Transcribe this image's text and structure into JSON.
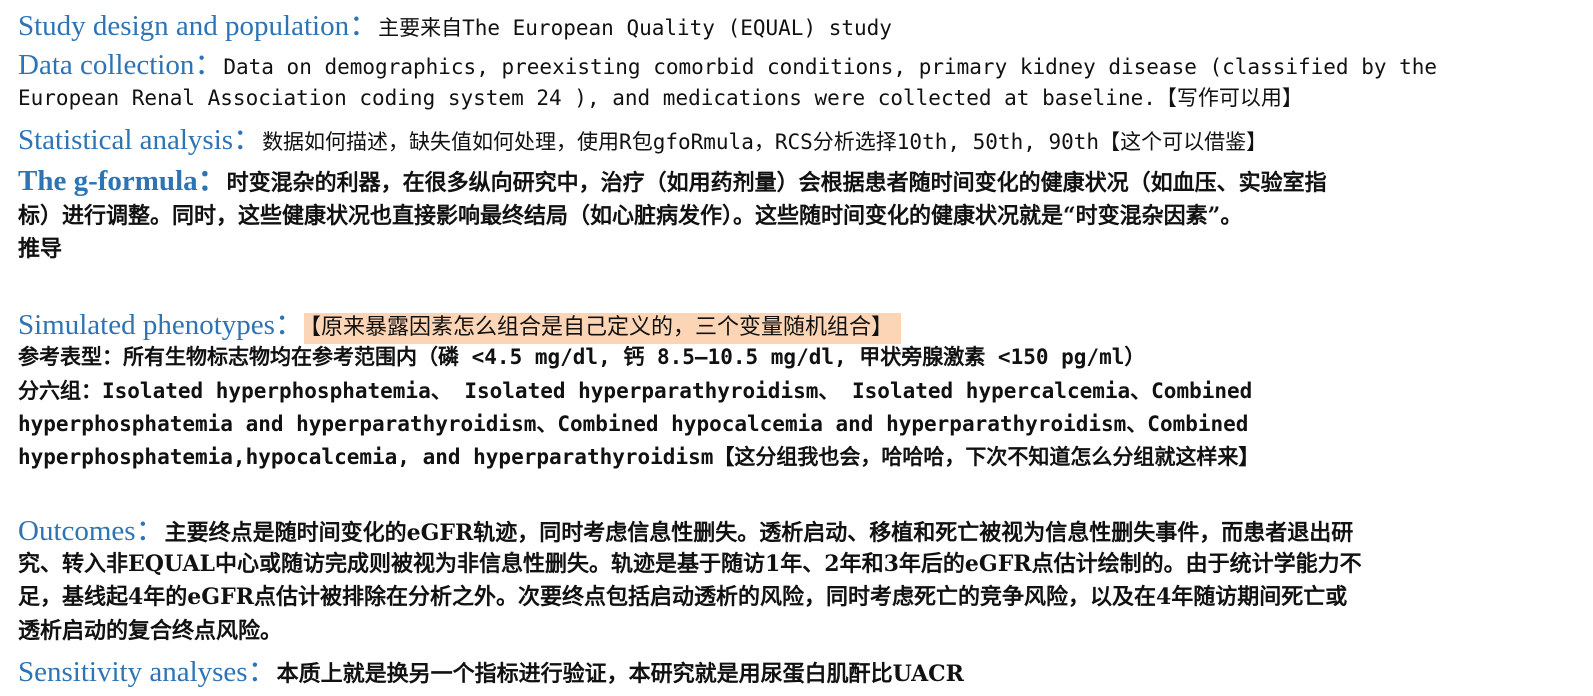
{
  "sections": {
    "study_design": {
      "heading": "Study design and population：",
      "text": "主要来自The European Quality (EQUAL) study"
    },
    "data_collection": {
      "heading": "Data collection：",
      "line1": "Data on demographics, preexisting comorbid conditions, primary kidney disease (classified by the",
      "line2": "European Renal Association coding system 24 ), and medications were collected at baseline.【写作可以用】"
    },
    "statistical_analysis": {
      "heading": "Statistical analysis：",
      "text": "数据如何描述，缺失值如何处理，使用R包gfoRmula，RCS分析选择10th, 50th, 90th【这个可以借鉴】"
    },
    "g_formula": {
      "heading": "The g-formula：",
      "line1": "时变混杂的利器，在很多纵向研究中，治疗（如用药剂量）会根据患者随时间变化的健康状况（如血压、实验室指",
      "line2": "标）进行调整。同时，这些健康状况也直接影响最终结局（如心脏病发作）。这些随时间变化的健康状况就是“时变混杂因素”。",
      "line3": "推导"
    },
    "simulated_phenotypes": {
      "heading": "Simulated phenotypes：",
      "note": "【原来暴露因素怎么组合是自己定义的，三个变量随机组合】",
      "line1": "参考表型：所有生物标志物均在参考范围内（磷 <4.5 mg/dl, 钙 8.5–10.5 mg/dl, 甲状旁腺激素 <150 pg/ml）",
      "line2": "分六组：Isolated hyperphosphatemia、 Isolated hyperparathyroidism、 Isolated hypercalcemia、Combined",
      "line3": "hyperphosphatemia and hyperparathyroidism、Combined hypocalcemia and hyperparathyroidism、Combined",
      "line4": "hyperphosphatemia,hypocalcemia, and hyperparathyroidism【这分组我也会，哈哈哈，下次不知道怎么分组就这样来】"
    },
    "outcomes": {
      "heading": "Outcomes：",
      "line1": "主要终点是随时间变化的eGFR轨迹，同时考虑信息性删失。透析启动、移植和死亡被视为信息性删失事件，而患者退出研",
      "line2": "究、转入非EQUAL中心或随访完成则被视为非信息性删失。轨迹是基于随访1年、2年和3年后的eGFR点估计绘制的。由于统计学能力不",
      "line3": "足，基线起4年的eGFR点估计被排除在分析之外。次要终点包括启动透析的风险，同时考虑死亡的竞争风险，以及在4年随访期间死亡或",
      "line4": "透析启动的复合终点风险。"
    },
    "sensitivity_analyses": {
      "heading": "Sensitivity analyses：",
      "text": "本质上就是换另一个指标进行验证，本研究就是用尿蛋白肌酐比UACR"
    }
  },
  "colors": {
    "heading": "#2e74b5",
    "highlight": "#fbd5b5",
    "text": "#111111"
  }
}
